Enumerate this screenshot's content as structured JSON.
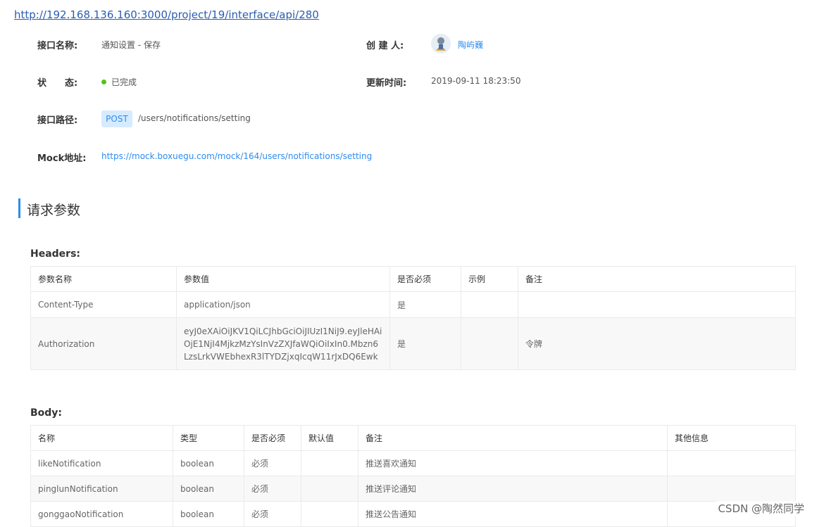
{
  "url": "http://192.168.136.160:3000/project/19/interface/api/280",
  "info": {
    "name_label": "接口名称:",
    "name_value": "通知设置 - 保存",
    "creator_label": "创 建 人:",
    "creator_name": "陶屿巍",
    "status_label": "状　　态:",
    "status_value": "已完成",
    "status_color": "#52c41a",
    "updated_label": "更新时间:",
    "updated_value": "2019-09-11 18:23:50",
    "path_label": "接口路径:",
    "method": "POST",
    "path": "/users/notifications/setting",
    "mock_label": "Mock地址:",
    "mock_url": "https://mock.boxuegu.com/mock/164/users/notifications/setting"
  },
  "section": {
    "title": "请求参数",
    "accent": "#2d8cf0"
  },
  "headers": {
    "title": "Headers:",
    "columns": [
      "参数名称",
      "参数值",
      "是否必须",
      "示例",
      "备注"
    ],
    "rows": [
      {
        "name": "Content-Type",
        "value": "application/json",
        "required": "是",
        "example": "",
        "note": ""
      },
      {
        "name": "Authorization",
        "value": "eyJ0eXAiOiJKV1QiLCJhbGciOiJIUzI1NiJ9.eyJleHAiOjE1NjI4MjkzMzYsInVzZXJfaWQiOiIxIn0.Mbzn6LzsLrkVWEbhexR3lTYDZjxqIcqW11rJxDQ6Ewk",
        "required": "是",
        "example": "",
        "note": "令牌"
      }
    ]
  },
  "body": {
    "title": "Body:",
    "columns": [
      "名称",
      "类型",
      "是否必须",
      "默认值",
      "备注",
      "其他信息"
    ],
    "rows": [
      {
        "name": "likeNotification",
        "type": "boolean",
        "required": "必须",
        "default": "",
        "note": "推送喜欢通知",
        "other": ""
      },
      {
        "name": "pinglunNotification",
        "type": "boolean",
        "required": "必须",
        "default": "",
        "note": "推送评论通知",
        "other": ""
      },
      {
        "name": "gonggaoNotification",
        "type": "boolean",
        "required": "必须",
        "default": "",
        "note": "推送公告通知",
        "other": ""
      }
    ]
  },
  "tag_colors": {
    "post_bg": "#d6ebff",
    "post_text": "#2d8cf0"
  },
  "watermark": "CSDN @陶然同学"
}
